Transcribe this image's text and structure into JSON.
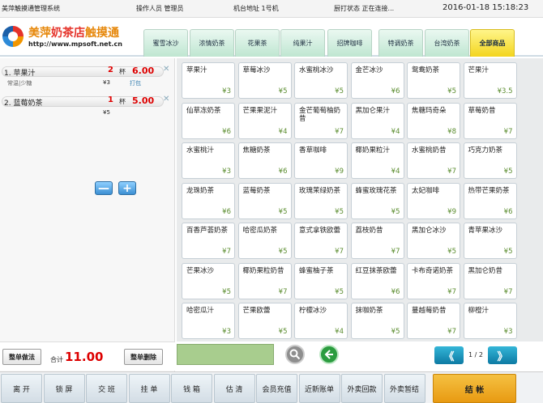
{
  "topbar": {
    "system_title": "美萍触摸通管理系统",
    "operator": "操作人员 管理员",
    "machine": "机台地址 1号机",
    "status": "厨打状态 正在连接...",
    "datetime": "2016-01-18 15:18:23"
  },
  "logo": {
    "title_part1": "美萍",
    "title_part2": "奶茶店",
    "title_part3": "触摸通",
    "url": "http://www.mpsoft.net.cn"
  },
  "categories": [
    "蜜雪冰沙",
    "浓情奶茶",
    "花果茶",
    "纯果汁",
    "招牌咖啡",
    "特调奶茶",
    "台湾奶茶",
    "全部商品"
  ],
  "order": {
    "items": [
      {
        "index_name": "1. 苹果汁",
        "qty": "2",
        "unit": "杯",
        "price": "6.00",
        "sub": "常温|少糖",
        "subprice": "¥3",
        "pack": "打包"
      },
      {
        "index_name": "2. 蓝莓奶茶",
        "qty": "1",
        "unit": "杯",
        "price": "5.00",
        "sub": "",
        "subprice": "¥5",
        "pack": ""
      }
    ],
    "minus_label": "—",
    "plus_label": "+",
    "left_button": "整单做法",
    "total_label": "合计",
    "total_value": "11.00",
    "delete_button": "整单删除"
  },
  "products": [
    {
      "name": "苹果汁",
      "price": "¥3"
    },
    {
      "name": "草莓冰沙",
      "price": "¥5"
    },
    {
      "name": "水蜜桃冰沙",
      "price": "¥5"
    },
    {
      "name": "金芒冰沙",
      "price": "¥6"
    },
    {
      "name": "鸳鸯奶茶",
      "price": "¥5"
    },
    {
      "name": "芒果汁",
      "price": "¥3.5"
    },
    {
      "name": "仙草冻奶茶",
      "price": "¥6"
    },
    {
      "name": "芒果果泥汁",
      "price": "¥4"
    },
    {
      "name": "金芒葡萄柚奶昔",
      "price": "¥7"
    },
    {
      "name": "黑加仑果汁",
      "price": "¥4"
    },
    {
      "name": "焦糖玛奇朵",
      "price": "¥8"
    },
    {
      "name": "草莓奶昔",
      "price": "¥7"
    },
    {
      "name": "水蜜桃汁",
      "price": "¥3"
    },
    {
      "name": "焦糖奶茶",
      "price": "¥6"
    },
    {
      "name": "香草咖啡",
      "price": "¥9"
    },
    {
      "name": "椰奶果粒汁",
      "price": "¥4"
    },
    {
      "name": "水蜜桃奶昔",
      "price": "¥7"
    },
    {
      "name": "巧克力奶茶",
      "price": "¥5"
    },
    {
      "name": "龙珠奶茶",
      "price": "¥6"
    },
    {
      "name": "蓝莓奶茶",
      "price": "¥5"
    },
    {
      "name": "玫瑰茉绿奶茶",
      "price": "¥5"
    },
    {
      "name": "蜂蜜玫瑰花茶",
      "price": "¥5"
    },
    {
      "name": "太妃咖啡",
      "price": "¥9"
    },
    {
      "name": "热带芒果奶茶",
      "price": "¥6"
    },
    {
      "name": "百香芦荟奶茶",
      "price": "¥7"
    },
    {
      "name": "哈密瓜奶茶",
      "price": "¥5"
    },
    {
      "name": "意式拿铁欧蕾",
      "price": "¥7"
    },
    {
      "name": "荔枝奶昔",
      "price": "¥7"
    },
    {
      "name": "黑加仑冰沙",
      "price": "¥5"
    },
    {
      "name": "青苹果冰沙",
      "price": "¥5"
    },
    {
      "name": "芒果冰沙",
      "price": "¥5"
    },
    {
      "name": "椰奶果粒奶昔",
      "price": "¥7"
    },
    {
      "name": "蜂蜜柚子茶",
      "price": "¥5"
    },
    {
      "name": "红豆抹茶欧蕾",
      "price": "¥6"
    },
    {
      "name": "卡布奇诺奶茶",
      "price": "¥7"
    },
    {
      "name": "黑加仑奶昔",
      "price": "¥7"
    },
    {
      "name": "哈密瓜汁",
      "price": "¥3"
    },
    {
      "name": "芒果欧蕾",
      "price": "¥5"
    },
    {
      "name": "柠檬冰沙",
      "price": "¥4"
    },
    {
      "name": "抹咖奶茶",
      "price": "¥5"
    },
    {
      "name": "蔓越莓奶昔",
      "price": "¥7"
    },
    {
      "name": "柳橙汁",
      "price": "¥3"
    }
  ],
  "pager": {
    "prev": "《",
    "next": "》",
    "info": "1 / 2"
  },
  "icons": {
    "search": "search-icon",
    "back": "back-arrow-icon"
  },
  "bottom": {
    "buttons": [
      "离 开",
      "锁 屏",
      "交 班",
      "挂 单",
      "钱 箱",
      "估 清",
      "会员充值",
      "近新账单",
      "外卖回款",
      "外卖暂结"
    ],
    "checkout": "结    帐"
  }
}
